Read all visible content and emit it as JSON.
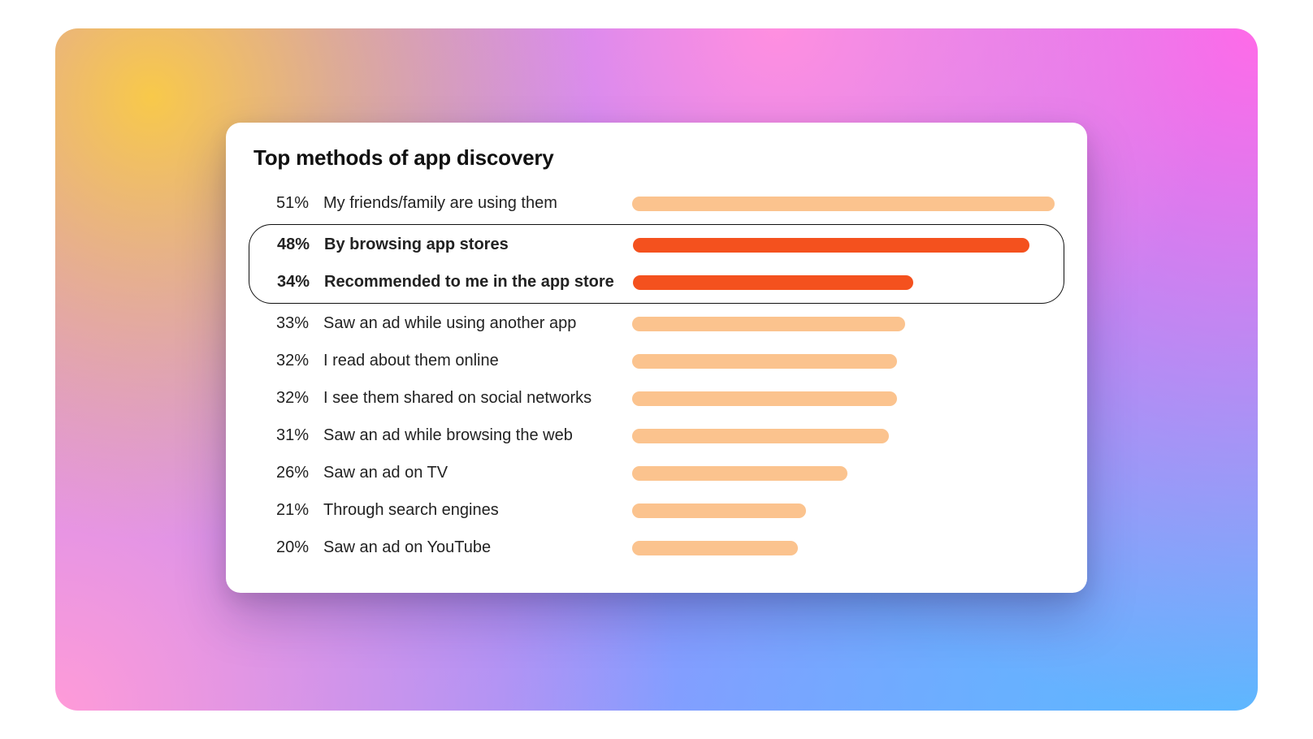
{
  "chart_data": {
    "type": "bar",
    "title": "Top methods of app discovery",
    "xlabel": "",
    "ylabel": "",
    "xlim": [
      0,
      51
    ],
    "categories": [
      "My friends/family are using them",
      "By browsing app stores",
      "Recommended to me in the app store",
      "Saw an ad while using another app",
      "I read about them online",
      "I see them shared on social networks",
      "Saw an ad while browsing the web",
      "Saw an ad on TV",
      "Through search engines",
      "Saw an ad on YouTube"
    ],
    "values": [
      51,
      48,
      34,
      33,
      32,
      32,
      31,
      26,
      21,
      20
    ],
    "value_suffix": "%",
    "highlighted_indices": [
      1,
      2
    ],
    "colors": {
      "default": "#fbc38e",
      "highlight": "#f4511e"
    }
  }
}
